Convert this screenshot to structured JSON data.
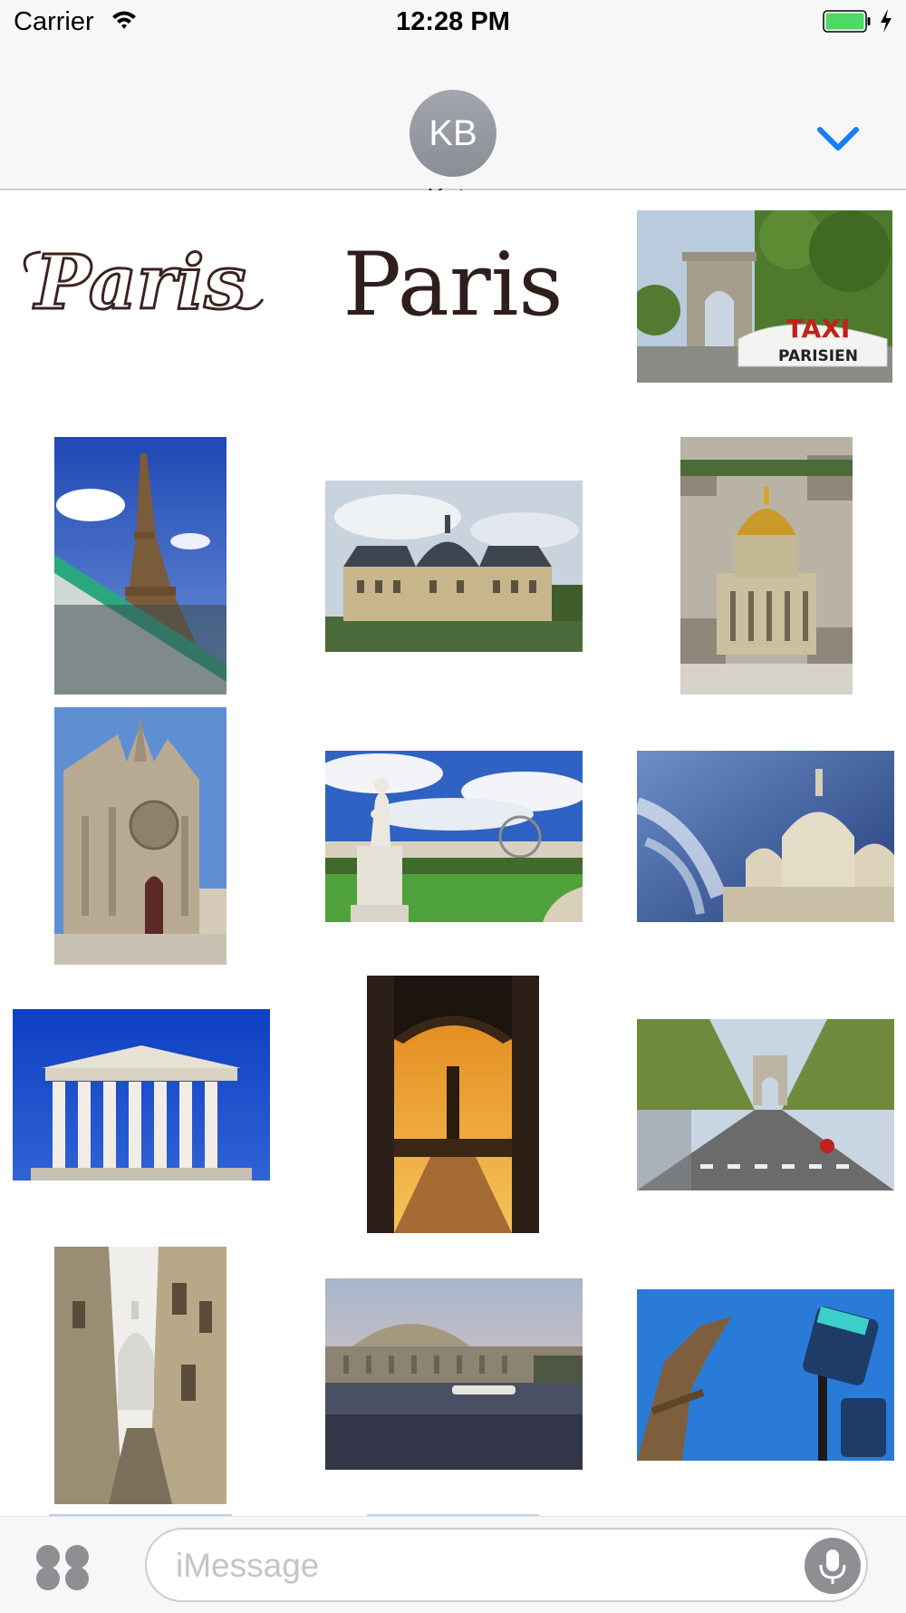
{
  "status_bar": {
    "carrier": "Carrier",
    "time": "12:28 PM",
    "battery_color": "#4cd964"
  },
  "header": {
    "avatar_initials": "KB",
    "contact_name": "Kate",
    "collapse_icon": "chevron-down-icon",
    "accent": "#147efb"
  },
  "stickers": [
    {
      "name": "paris-ornate-text-sticker",
      "text": "Paris"
    },
    {
      "name": "paris-serif-text-sticker",
      "text": "Paris"
    },
    {
      "name": "arc-de-triomphe-taxi-sticker",
      "sign_line1": "TAXI",
      "sign_line2": "PARISIEN"
    },
    {
      "name": "eiffel-tower-tram-sticker"
    },
    {
      "name": "chateau-vaux-le-vicomte-sticker"
    },
    {
      "name": "les-invalides-dome-sticker"
    },
    {
      "name": "sainte-chapelle-sticker"
    },
    {
      "name": "tuileries-garden-statue-sticker"
    },
    {
      "name": "sacre-coeur-sticker"
    },
    {
      "name": "la-madeleine-church-sticker"
    },
    {
      "name": "place-vendome-doorway-sticker"
    },
    {
      "name": "champs-elysees-sticker"
    },
    {
      "name": "montmartre-alley-sticker"
    },
    {
      "name": "musee-d-orsay-seine-sticker"
    },
    {
      "name": "eiffel-tower-metro-sign-sticker"
    }
  ],
  "compose": {
    "apps_icon": "app-drawer-icon",
    "placeholder": "iMessage",
    "mic_icon": "microphone-icon"
  }
}
